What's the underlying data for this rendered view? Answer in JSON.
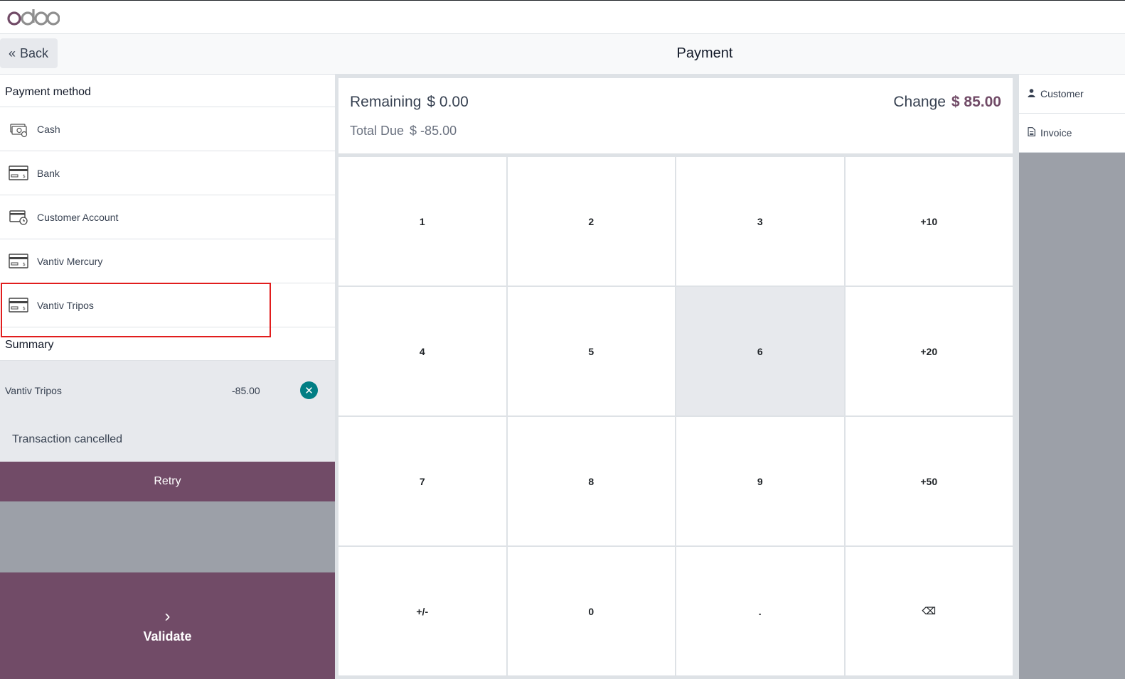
{
  "app": {
    "logo_text": "odoo"
  },
  "header": {
    "back_label": "Back",
    "title": "Payment"
  },
  "payment_methods": {
    "title": "Payment method",
    "items": [
      {
        "label": "Cash",
        "icon": "cash-icon"
      },
      {
        "label": "Bank",
        "icon": "card-icon"
      },
      {
        "label": "Customer Account",
        "icon": "customer-account-icon"
      },
      {
        "label": "Vantiv Mercury",
        "icon": "card-icon"
      },
      {
        "label": "Vantiv Tripos",
        "icon": "card-icon"
      }
    ]
  },
  "summary": {
    "title": "Summary",
    "lines": [
      {
        "method": "Vantiv Tripos",
        "amount": "-85.00"
      }
    ],
    "status": "Transaction cancelled",
    "retry_label": "Retry"
  },
  "validate": {
    "label": "Validate",
    "icon": "chevron-right-icon"
  },
  "totals": {
    "remaining_label": "Remaining",
    "remaining_value": "$ 0.00",
    "total_due_label": "Total Due",
    "total_due_value": "$ -85.00",
    "change_label": "Change",
    "change_value": "$ 85.00"
  },
  "numpad": {
    "keys": [
      "1",
      "2",
      "3",
      "+10",
      "4",
      "5",
      "6",
      "+20",
      "7",
      "8",
      "9",
      "+50",
      "+/-",
      "0",
      ".",
      "⌫"
    ],
    "active_key": "6"
  },
  "side": {
    "customer_label": "Customer",
    "invoice_label": "Invoice"
  },
  "colors": {
    "brand": "#714b67",
    "accent": "#017e84",
    "highlight": "#e11d1d"
  }
}
